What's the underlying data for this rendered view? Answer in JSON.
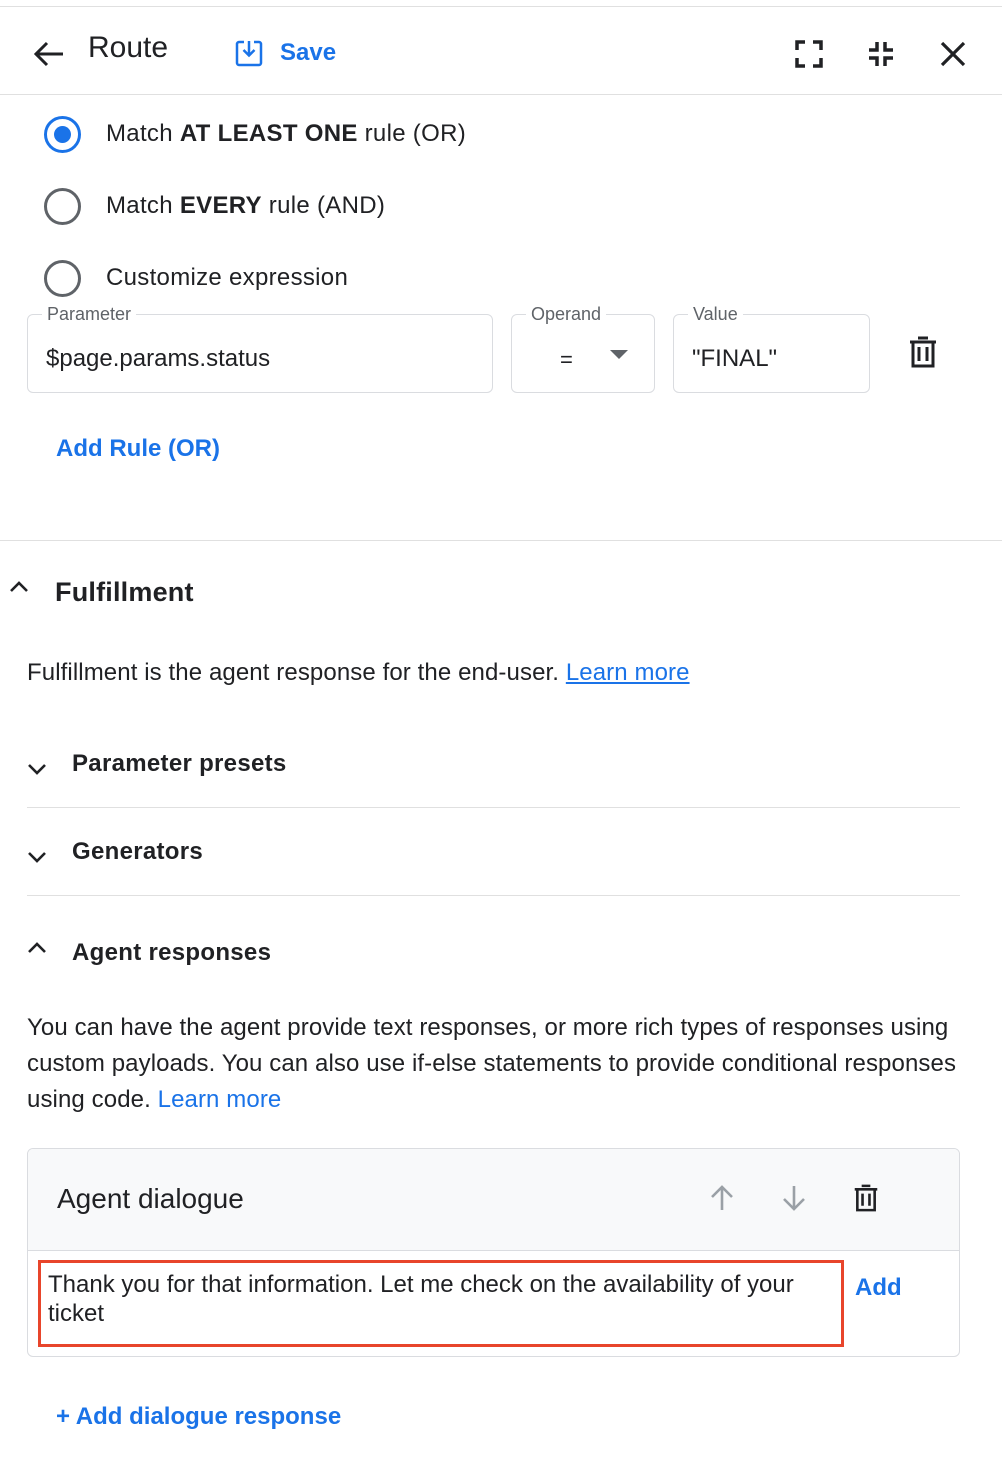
{
  "header": {
    "title": "Route",
    "save_label": "Save"
  },
  "condition": {
    "options": [
      {
        "prefix": "Match ",
        "bold": "AT LEAST ONE",
        "suffix": " rule (OR)",
        "checked": true
      },
      {
        "prefix": "Match ",
        "bold": "EVERY",
        "suffix": " rule (AND)",
        "checked": false
      },
      {
        "prefix": "Customize expression",
        "bold": "",
        "suffix": "",
        "checked": false
      }
    ],
    "rule": {
      "parameter_label": "Parameter",
      "parameter_value": "$page.params.status",
      "operand_label": "Operand",
      "operand_value": "=",
      "value_label": "Value",
      "value_value": "\"FINAL\""
    },
    "add_rule_label": "Add Rule (OR)"
  },
  "fulfillment": {
    "title": "Fulfillment",
    "description": "Fulfillment is the agent response for the end-user. ",
    "learn_more": "Learn more",
    "parameter_presets": "Parameter presets",
    "generators": "Generators",
    "agent_responses": {
      "title": "Agent responses",
      "description": "You can have the agent provide text responses, or more rich types of responses using custom payloads. You can also use if-else statements to provide conditional responses using code. ",
      "learn_more": "Learn more",
      "card": {
        "title": "Agent dialogue",
        "message": "Thank you for that information. Let me check on the availability of your ticket",
        "add_label": "Add"
      },
      "add_dialogue_label": "+ Add dialogue response"
    }
  },
  "colors": {
    "accent": "#1a73e8",
    "highlight": "#e8452b"
  }
}
